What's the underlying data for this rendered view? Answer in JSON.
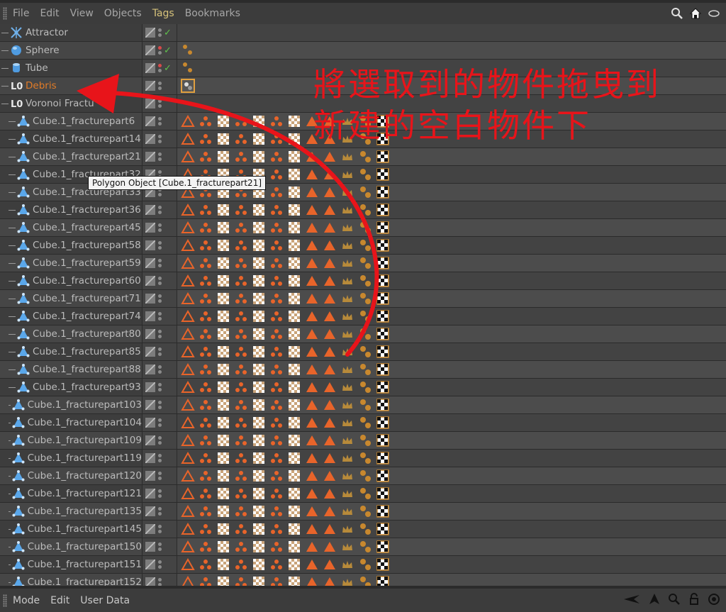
{
  "menubar": {
    "items": [
      "File",
      "Edit",
      "View",
      "Objects",
      "Tags",
      "Bookmarks"
    ],
    "active": "Tags",
    "right_icons": [
      "search-icon",
      "home-icon",
      "eye-icon"
    ]
  },
  "top_objects": [
    {
      "name": "Attractor",
      "icon": "attractor-icon",
      "color": "normal",
      "red_dot": false,
      "check": true,
      "tags": []
    },
    {
      "name": "Sphere",
      "icon": "sphere-icon",
      "color": "normal",
      "red_dot": true,
      "check": true,
      "tags": [
        "dots"
      ]
    },
    {
      "name": "Tube",
      "icon": "tube-icon",
      "color": "normal",
      "red_dot": true,
      "check": true,
      "tags": [
        "dots"
      ]
    },
    {
      "name": "Debris",
      "icon": "null-icon",
      "color": "orange",
      "red_dot": false,
      "check": false,
      "tags": [
        "selected-tag"
      ]
    },
    {
      "name": "Voronoi Fractu",
      "icon": "null-icon",
      "color": "normal",
      "red_dot": false,
      "check": false,
      "tags": []
    }
  ],
  "fracture_parts": [
    "Cube.1_fracturepart6",
    "Cube.1_fracturepart14",
    "Cube.1_fracturepart21",
    "Cube.1_fracturepart32",
    "Cube.1_fracturepart33",
    "Cube.1_fracturepart36",
    "Cube.1_fracturepart45",
    "Cube.1_fracturepart58",
    "Cube.1_fracturepart59",
    "Cube.1_fracturepart60",
    "Cube.1_fracturepart71",
    "Cube.1_fracturepart74",
    "Cube.1_fracturepart80",
    "Cube.1_fracturepart85",
    "Cube.1_fracturepart88",
    "Cube.1_fracturepart93",
    "Cube.1_fracturepart103",
    "Cube.1_fracturepart104",
    "Cube.1_fracturepart109",
    "Cube.1_fracturepart119",
    "Cube.1_fracturepart120",
    "Cube.1_fracturepart121",
    "Cube.1_fracturepart135",
    "Cube.1_fracturepart145",
    "Cube.1_fracturepart150",
    "Cube.1_fracturepart151",
    "Cube.1_fracturepart152"
  ],
  "tag_sequence": [
    "tri-outline",
    "dots3",
    "checker",
    "dots3",
    "checker",
    "dots3",
    "checker",
    "tri-solid",
    "tri-solid",
    "crown",
    "dots2",
    "checker-bw"
  ],
  "tooltip": "Polygon Object [Cube.1_fracturepart21]",
  "annotation": {
    "line1": "將選取到的物件拖曳到",
    "line2": "新建的空白物件下"
  },
  "colors": {
    "annotation_red": "#e8141a",
    "tag_orange": "#e8642a",
    "selected_name": "#e07b27"
  },
  "bottombar": {
    "items": [
      "Mode",
      "Edit",
      "User Data"
    ],
    "right_icons": [
      "back-arrow-icon",
      "pointer-icon",
      "search-icon",
      "lock-icon",
      "target-icon"
    ]
  }
}
